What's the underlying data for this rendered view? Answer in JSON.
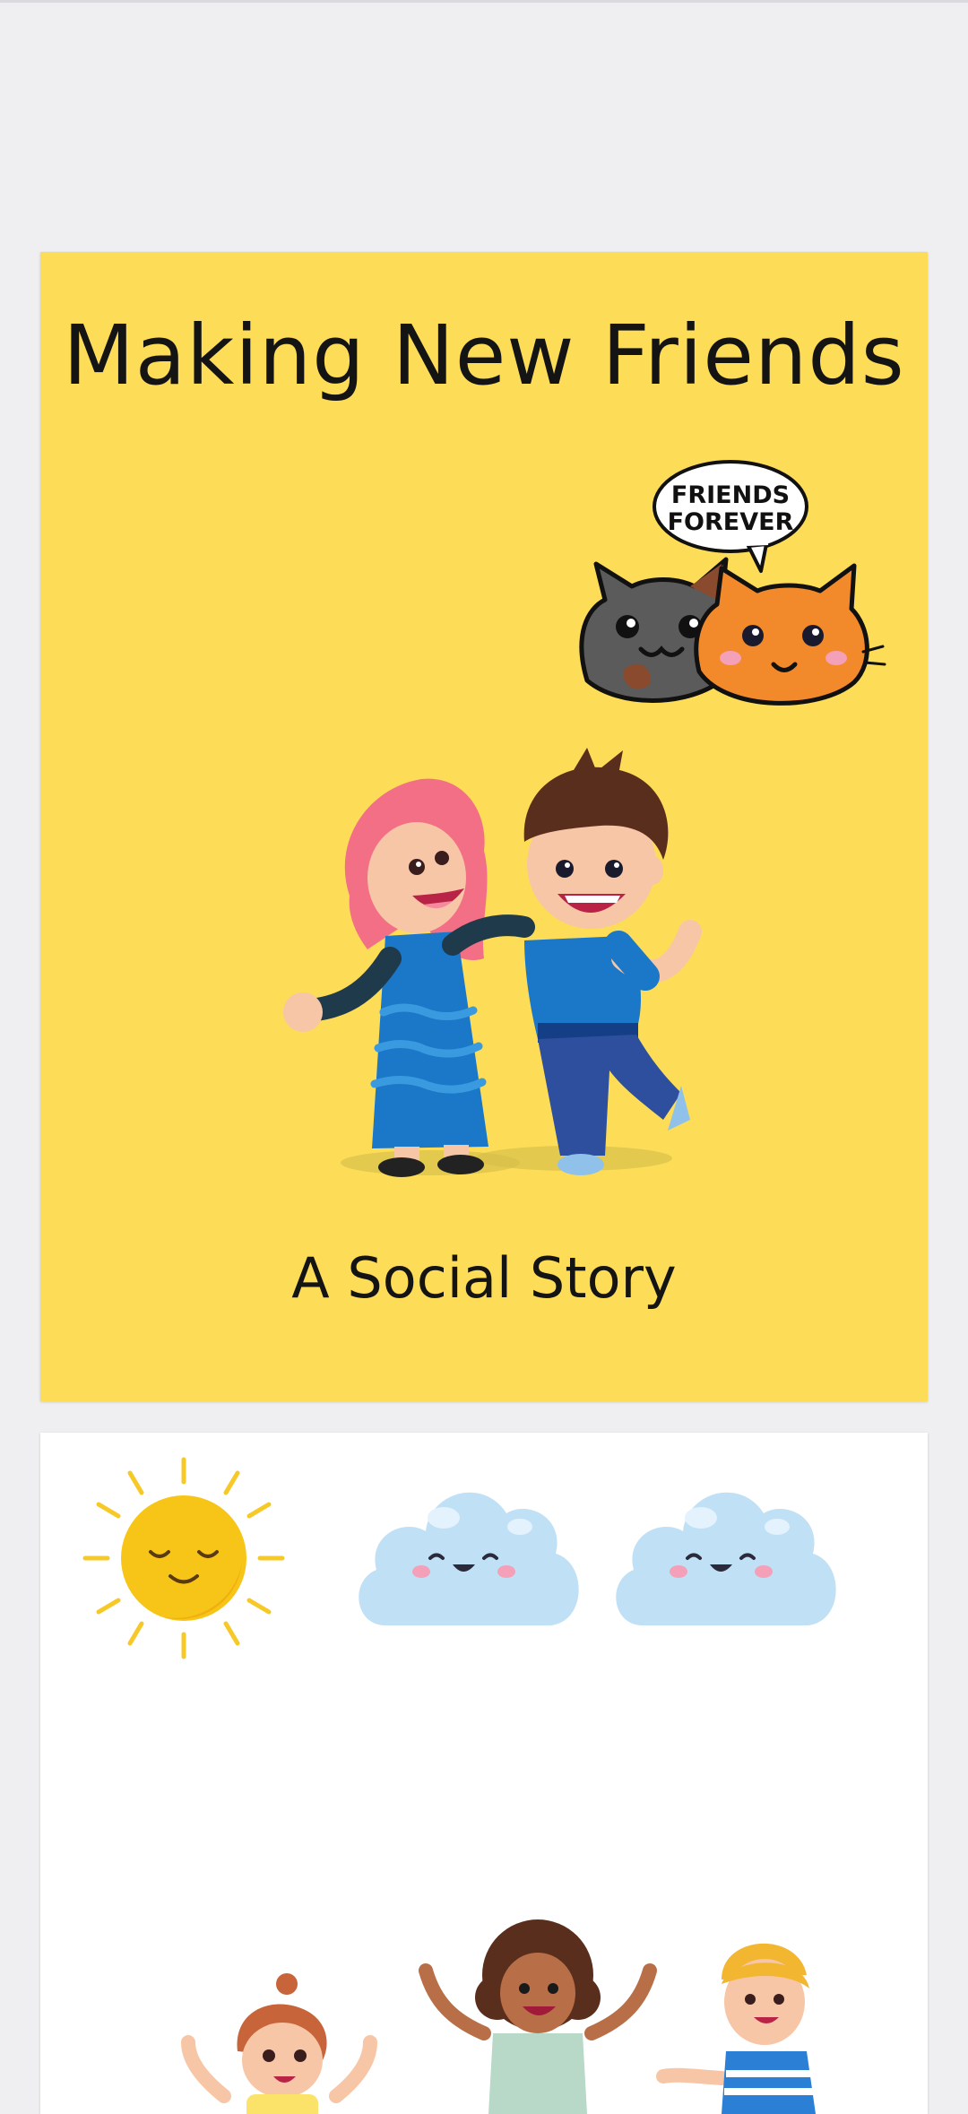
{
  "cover": {
    "title": "Making New Friends",
    "subtitle": "A Social Story",
    "bubble_line1": "FRIENDS",
    "bubble_line2": "FOREVER",
    "background": "#fddc58"
  },
  "page_two": {
    "background": "#ffffff"
  },
  "icons": {
    "cats": "two-cats-friends-forever-illustration",
    "kids": "two-kids-hugging-illustration",
    "sun": "smiling-sun-icon",
    "clouds": "smiling-cloud-icon",
    "children": "cheering-children-illustration"
  }
}
